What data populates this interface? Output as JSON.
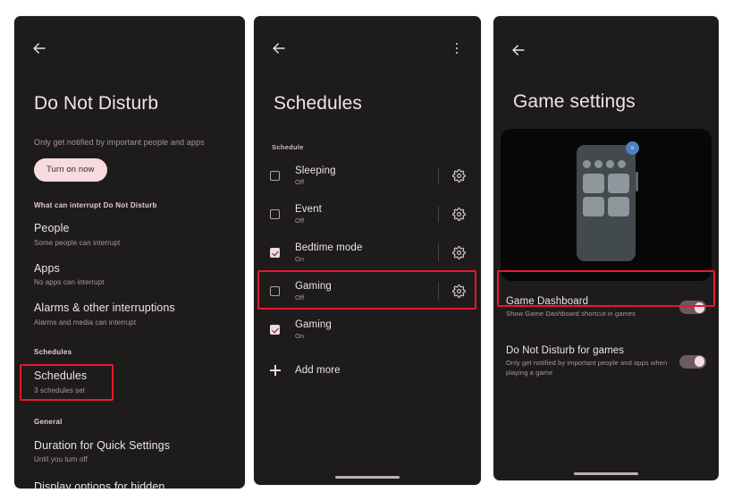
{
  "theme": {
    "page_bg": "#ffffff",
    "panel_bg": "#1e1b1b",
    "accent_pink": "#f4d9de",
    "muted_text": "#a89a9b",
    "highlight_red": "#e8192c",
    "hero_bg": "#070707",
    "switch_track": "#6d5a5f",
    "blue_badge": "#4f7fc4"
  },
  "panels": {
    "dnd": {
      "back_icon": "arrow-left-icon",
      "title": "Do Not Disturb",
      "subtitle": "Only get notified by important people and apps",
      "turn_on_button": "Turn on now",
      "section_interrupt": "What can interrupt Do Not Disturb",
      "items_interrupt": [
        {
          "title": "People",
          "sub": "Some people can interrupt"
        },
        {
          "title": "Apps",
          "sub": "No apps can interrupt"
        },
        {
          "title": "Alarms & other interruptions",
          "sub": "Alarms and media can interrupt"
        }
      ],
      "section_schedules": "Schedules",
      "schedules_item": {
        "title": "Schedules",
        "sub": "3 schedules set"
      },
      "section_general": "General",
      "items_general": [
        {
          "title": "Duration for Quick Settings",
          "sub": "Until you turn off"
        },
        {
          "title": "Display options for hidden notifications",
          "sub": ""
        }
      ]
    },
    "schedules": {
      "back_icon": "arrow-left-icon",
      "overflow_icon": "more-vertical-icon",
      "title": "Schedules",
      "section_label": "Schedule",
      "rows": [
        {
          "name": "Sleeping",
          "state": "Off",
          "checked": false,
          "has_gear": true
        },
        {
          "name": "Event",
          "state": "Off",
          "checked": false,
          "has_gear": true
        },
        {
          "name": "Bedtime mode",
          "state": "On",
          "checked": true,
          "has_gear": true
        },
        {
          "name": "Gaming",
          "state": "Off",
          "checked": false,
          "has_gear": true
        },
        {
          "name": "Gaming",
          "state": "On",
          "checked": true,
          "has_gear": false
        }
      ],
      "add_more": "Add more",
      "add_more_icon": "plus-icon",
      "gear_icon": "gear-icon"
    },
    "game": {
      "back_icon": "arrow-left-icon",
      "title": "Game settings",
      "hero_image_alt": "game-dashboard-illustration",
      "hero_close_glyph": "×",
      "rows": [
        {
          "title": "Game Dashboard",
          "sub": "Show Game Dashboard shortcut in games",
          "toggle_on": true
        },
        {
          "title": "Do Not Disturb for games",
          "sub": "Only get notified by important people and apps when playing a game",
          "toggle_on": true
        }
      ]
    }
  },
  "annotations": [
    {
      "target": "dnd-schedules-item"
    },
    {
      "target": "schedules-gaming-off-row"
    },
    {
      "target": "game-dashboard-row"
    }
  ]
}
